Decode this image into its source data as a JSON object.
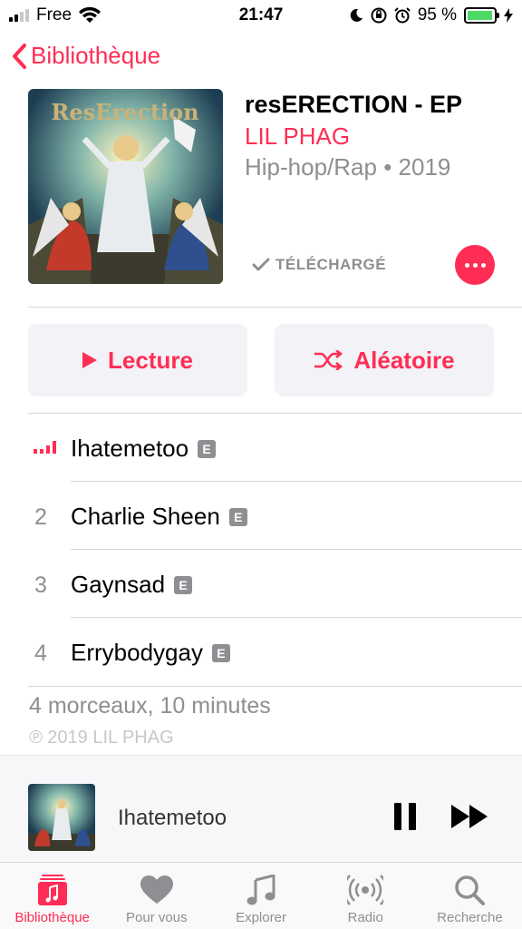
{
  "status_bar": {
    "carrier": "Free",
    "time": "21:47",
    "battery": "95 %",
    "battery_level": 0.95
  },
  "nav": {
    "back_label": "Bibliothèque"
  },
  "album": {
    "title": "resERECTION - EP",
    "artist": "LIL PHAG",
    "meta": "Hip-hop/Rap • 2019",
    "downloaded_label": "TÉLÉCHARGÉ",
    "art_text": "ResErection"
  },
  "actions": {
    "play_label": "Lecture",
    "shuffle_label": "Aléatoire"
  },
  "tracks": [
    {
      "number": "",
      "title": "Ihatemetoo",
      "explicit": "E",
      "playing": true
    },
    {
      "number": "2",
      "title": "Charlie Sheen",
      "explicit": "E",
      "playing": false
    },
    {
      "number": "3",
      "title": "Gaynsad",
      "explicit": "E",
      "playing": false
    },
    {
      "number": "4",
      "title": "Errybodygay",
      "explicit": "E",
      "playing": false
    }
  ],
  "footer": {
    "summary": "4 morceaux, 10 minutes",
    "copyright": "℗ 2019 LIL PHAG"
  },
  "mini_player": {
    "title": "Ihatemetoo"
  },
  "tabs": [
    {
      "label": "Bibliothèque",
      "icon": "library-icon",
      "active": true
    },
    {
      "label": "Pour vous",
      "icon": "heart-icon",
      "active": false
    },
    {
      "label": "Explorer",
      "icon": "music-note-icon",
      "active": false
    },
    {
      "label": "Radio",
      "icon": "radio-icon",
      "active": false
    },
    {
      "label": "Recherche",
      "icon": "search-icon",
      "active": false
    }
  ],
  "colors": {
    "accent": "#ff2d55",
    "secondary_text": "#8e8e93",
    "battery": "#4cd964"
  }
}
